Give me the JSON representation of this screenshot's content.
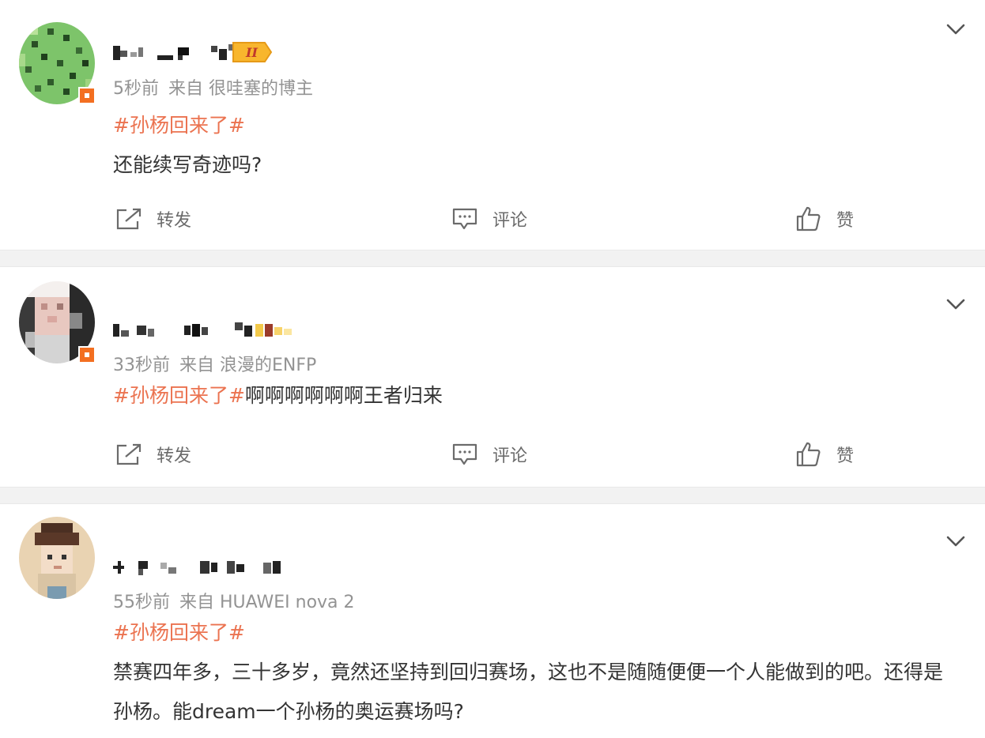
{
  "colors": {
    "topic": "#eb7350",
    "text": "#333333",
    "meta": "#939393",
    "action": "#6b6b6b",
    "divider": "#f2f2f2"
  },
  "posts": [
    {
      "time": "5秒前",
      "source": "来自 很哇塞的博主",
      "topic": "#孙杨回来了#",
      "body": "还能续写奇迹吗?",
      "avatar_icon": "pixelated-green-avatar",
      "level_badge": "II"
    },
    {
      "time": "33秒前",
      "source": "来自 浪漫的ENFP",
      "topic": "#孙杨回来了#",
      "body": "啊啊啊啊啊啊王者归来",
      "avatar_icon": "pixelated-portrait-avatar"
    },
    {
      "time": "55秒前",
      "source": "来自 HUAWEI nova 2",
      "topic": "#孙杨回来了#",
      "body": "禁赛四年多，三十多岁，竟然还坚持到回归赛场，这也不是随随便便一个人能做到的吧。还得是孙杨。能dream一个孙杨的奥运赛场吗?",
      "avatar_icon": "pixelated-cartoon-avatar"
    }
  ],
  "actions": {
    "repost": "转发",
    "comment": "评论",
    "like": "赞"
  }
}
